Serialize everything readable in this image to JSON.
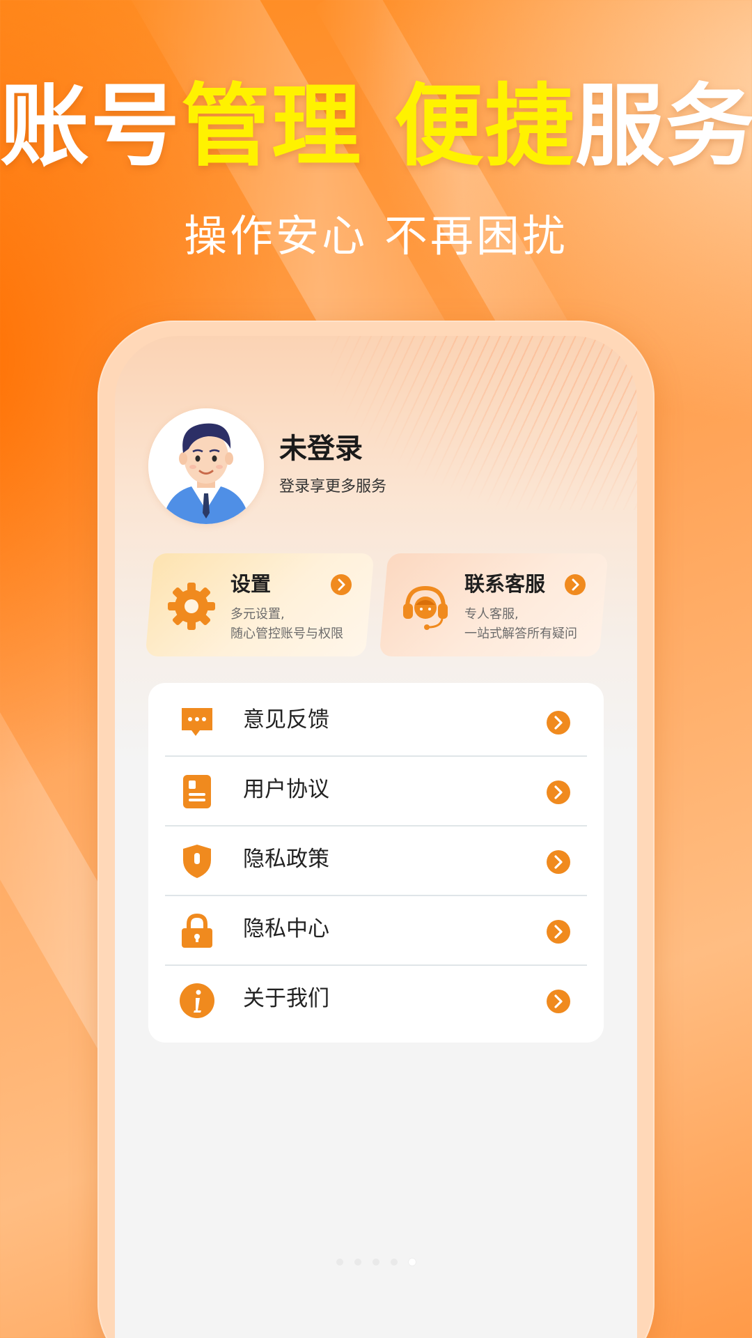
{
  "colors": {
    "accent_orange": "#f08a1e",
    "headline_highlight": "#fff200",
    "headline_white": "#ffffff"
  },
  "banner": {
    "headline_part1": "账号",
    "headline_part2": "管理",
    "headline_part3": "便捷",
    "headline_part4": "服务",
    "subline": "操作安心 不再困扰"
  },
  "profile": {
    "avatar_icon": "user-avatar-icon",
    "name": "未登录",
    "subtitle": "登录享更多服务"
  },
  "cards": {
    "settings": {
      "icon": "gear-icon",
      "title": "设置",
      "desc_line1": "多元设置,",
      "desc_line2": "随心管控账号与权限"
    },
    "service": {
      "icon": "headset-icon",
      "title": "联系客服",
      "desc_line1": "专人客服,",
      "desc_line2": "一站式解答所有疑问"
    }
  },
  "menu": {
    "items": [
      {
        "label": "意见反馈",
        "icon": "feedback-icon"
      },
      {
        "label": "用户协议",
        "icon": "agreement-icon"
      },
      {
        "label": "隐私政策",
        "icon": "shield-icon"
      },
      {
        "label": "隐私中心",
        "icon": "lock-icon"
      },
      {
        "label": "关于我们",
        "icon": "info-icon"
      }
    ]
  },
  "pager": {
    "page_count": 5,
    "active_index": 5
  }
}
